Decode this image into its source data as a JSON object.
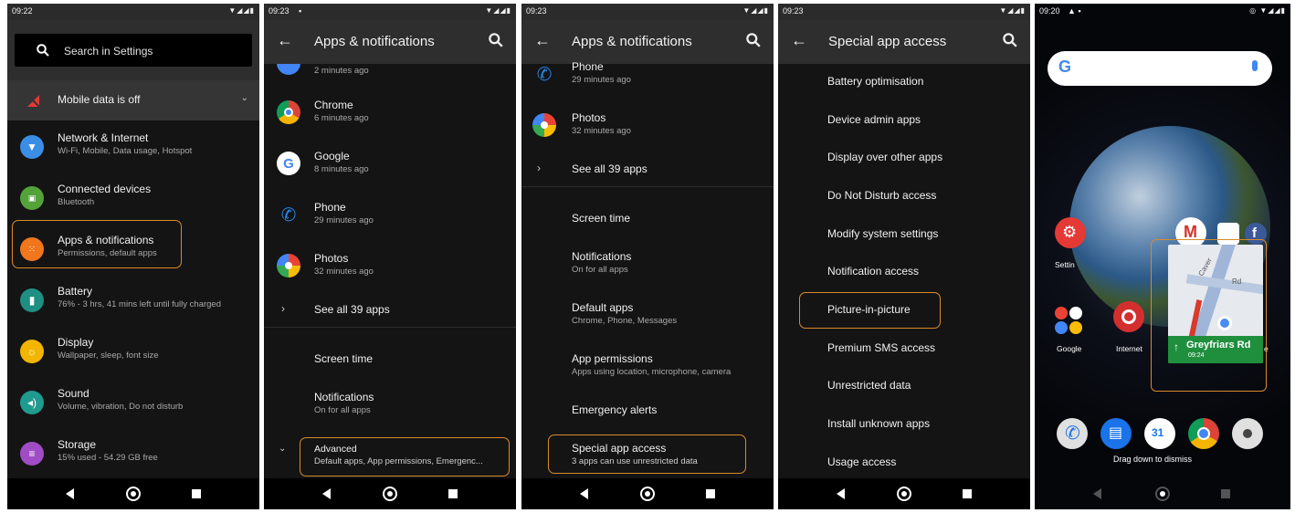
{
  "screen1": {
    "time": "09:22",
    "search_label": "Search in Settings",
    "mobile_data": "Mobile data is off",
    "items": [
      {
        "title": "Network & Internet",
        "sub": "Wi-Fi, Mobile, Data usage, Hotspot",
        "color": "#3a8ee6"
      },
      {
        "title": "Connected devices",
        "sub": "Bluetooth",
        "color": "#53a33a"
      },
      {
        "title": "Apps & notifications",
        "sub": "Permissions, default apps",
        "color": "#f0771c"
      },
      {
        "title": "Battery",
        "sub": "76% - 3 hrs, 41 mins left until fully charged",
        "color": "#1f8f84"
      },
      {
        "title": "Display",
        "sub": "Wallpaper, sleep, font size",
        "color": "#f2b500"
      },
      {
        "title": "Sound",
        "sub": "Volume, vibration, Do not disturb",
        "color": "#1f9a8f"
      },
      {
        "title": "Storage",
        "sub": "15% used - 54.29 GB free",
        "color": "#a04cc4"
      }
    ]
  },
  "screen2": {
    "time": "09:23",
    "title": "Apps & notifications",
    "top_cut_sub": "2 minutes ago",
    "apps": [
      {
        "title": "Chrome",
        "sub": "6 minutes ago"
      },
      {
        "title": "Google",
        "sub": "8 minutes ago"
      },
      {
        "title": "Phone",
        "sub": "29 minutes ago"
      },
      {
        "title": "Photos",
        "sub": "32 minutes ago"
      }
    ],
    "see_all": "See all 39 apps",
    "screen_time": "Screen time",
    "notifications": {
      "title": "Notifications",
      "sub": "On for all apps"
    },
    "advanced": {
      "title": "Advanced",
      "sub": "Default apps, App permissions, Emergenc..."
    }
  },
  "screen3": {
    "time": "09:23",
    "title": "Apps & notifications",
    "apps": [
      {
        "title": "Phone",
        "sub": "29 minutes ago"
      },
      {
        "title": "Photos",
        "sub": "32 minutes ago"
      }
    ],
    "see_all": "See all 39 apps",
    "items": [
      {
        "title": "Screen time",
        "sub": ""
      },
      {
        "title": "Notifications",
        "sub": "On for all apps"
      },
      {
        "title": "Default apps",
        "sub": "Chrome, Phone, Messages"
      },
      {
        "title": "App permissions",
        "sub": "Apps using location, microphone, camera"
      },
      {
        "title": "Emergency alerts",
        "sub": ""
      }
    ],
    "special": {
      "title": "Special app access",
      "sub": "3 apps can use unrestricted data"
    }
  },
  "screen4": {
    "time": "09:23",
    "title": "Special app access",
    "items": [
      "Battery optimisation",
      "Device admin apps",
      "Display over other apps",
      "Do Not Disturb access",
      "Modify system settings",
      "Notification access",
      "Picture-in-picture",
      "Premium SMS access",
      "Unrestricted data",
      "Install unknown apps",
      "Usage access"
    ]
  },
  "screen5": {
    "time": "09:20",
    "labels": {
      "settings": "Settin",
      "google": "Google",
      "internet": "Internet",
      "e": "e"
    },
    "pip": {
      "street": "Greyfriars Rd",
      "time": "09:24",
      "map_road": "Caver",
      "map_rd": "Rd"
    },
    "dismiss": "Drag down to dismiss",
    "calendar_day": "31"
  }
}
